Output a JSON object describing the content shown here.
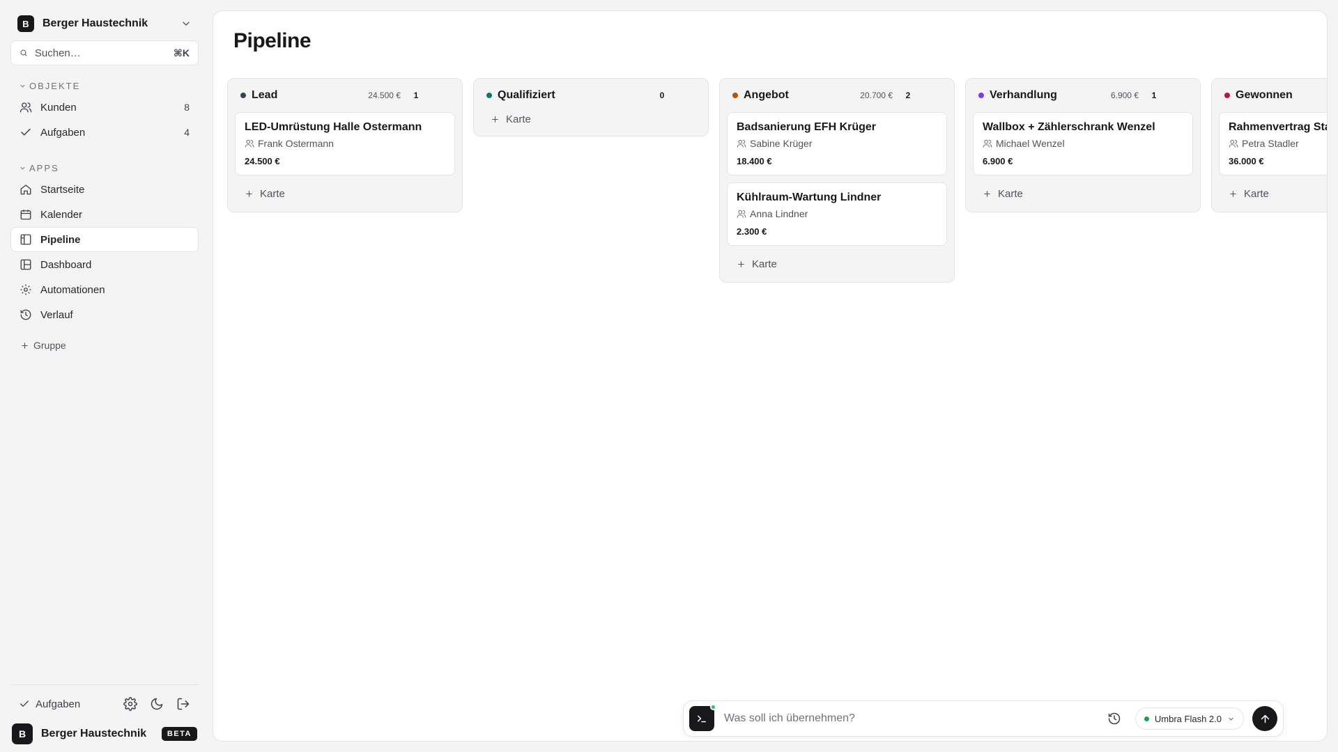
{
  "workspace": {
    "avatar_letter": "B",
    "name": "Berger Haustechnik"
  },
  "search": {
    "placeholder": "Suchen…",
    "shortcut": "⌘K"
  },
  "sidebar": {
    "objects_heading": "OBJEKTE",
    "objects": [
      {
        "label": "Kunden",
        "count": "8",
        "icon": "users-icon"
      },
      {
        "label": "Aufgaben",
        "count": "4",
        "icon": "check-icon"
      }
    ],
    "apps_heading": "APPS",
    "apps": [
      {
        "label": "Startseite",
        "icon": "home-icon"
      },
      {
        "label": "Kalender",
        "icon": "calendar-icon"
      },
      {
        "label": "Pipeline",
        "icon": "board-icon",
        "active": true
      },
      {
        "label": "Dashboard",
        "icon": "dashboard-icon"
      },
      {
        "label": "Automationen",
        "icon": "gear-icon"
      },
      {
        "label": "Verlauf",
        "icon": "history-icon"
      }
    ],
    "add_group_label": "Gruppe",
    "footer": {
      "tasks_label": "Aufgaben",
      "avatar_letter": "B",
      "name": "Berger Haustechnik",
      "badge": "BETA"
    }
  },
  "page": {
    "title": "Pipeline"
  },
  "add_card_label": "Karte",
  "columns": [
    {
      "title": "Lead",
      "total": "24.500 €",
      "count": "1",
      "color": "#334155",
      "cards": [
        {
          "title": "LED-Umrüstung Halle Ostermann",
          "person": "Frank Ostermann",
          "value": "24.500 €"
        }
      ]
    },
    {
      "title": "Qualifiziert",
      "total": "",
      "count": "0",
      "color": "#0f766e",
      "cards": []
    },
    {
      "title": "Angebot",
      "total": "20.700 €",
      "count": "2",
      "color": "#b45309",
      "cards": [
        {
          "title": "Badsanierung EFH Krüger",
          "person": "Sabine Krüger",
          "value": "18.400 €"
        },
        {
          "title": "Kühlraum-Wartung Lindner",
          "person": "Anna Lindner",
          "value": "2.300 €"
        }
      ]
    },
    {
      "title": "Verhandlung",
      "total": "6.900 €",
      "count": "1",
      "color": "#7c3aed",
      "cards": [
        {
          "title": "Wallbox + Zählerschrank Wenzel",
          "person": "Michael Wenzel",
          "value": "6.900 €"
        }
      ]
    },
    {
      "title": "Gewonnen",
      "total": "",
      "count": "",
      "color": "#be123c",
      "cards": [
        {
          "title": "Rahmenvertrag Sta",
          "person": "Petra Stadler",
          "value": "36.000 €"
        }
      ]
    }
  ],
  "command_bar": {
    "placeholder": "Was soll ich übernehmen?",
    "model_label": "Umbra Flash 2.0",
    "model_status_color": "#16a34a"
  }
}
